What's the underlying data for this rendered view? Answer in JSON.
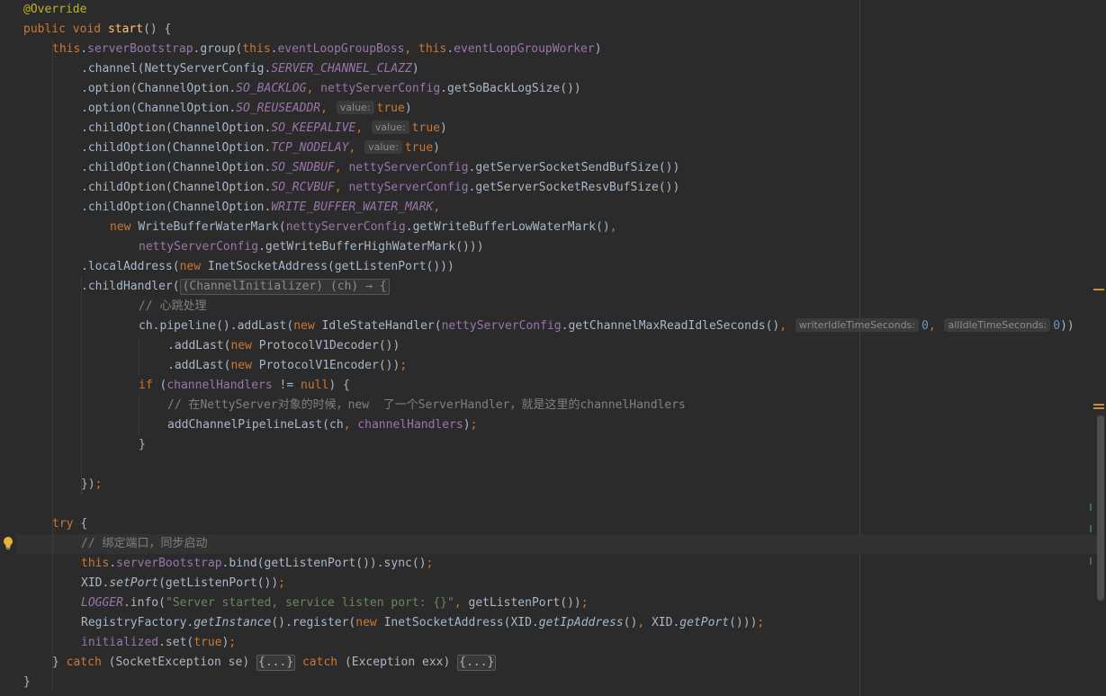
{
  "editor": {
    "lines": [
      {
        "indent": 0,
        "tokens": [
          {
            "t": "@Override",
            "c": "ann"
          }
        ]
      },
      {
        "indent": 0,
        "tokens": [
          {
            "t": "public ",
            "c": "kw"
          },
          {
            "t": "void ",
            "c": "kw"
          },
          {
            "t": "start",
            "c": "method"
          },
          {
            "t": "() {",
            "c": "plain"
          }
        ]
      },
      {
        "indent": 1,
        "tokens": [
          {
            "t": "this",
            "c": "kw"
          },
          {
            "t": ".",
            "c": "plain"
          },
          {
            "t": "serverBootstrap",
            "c": "field"
          },
          {
            "t": ".group(",
            "c": "plain"
          },
          {
            "t": "this",
            "c": "kw"
          },
          {
            "t": ".",
            "c": "plain"
          },
          {
            "t": "eventLoopGroupBoss",
            "c": "field"
          },
          {
            "t": ", ",
            "c": "kw"
          },
          {
            "t": "this",
            "c": "kw"
          },
          {
            "t": ".",
            "c": "plain"
          },
          {
            "t": "eventLoopGroupWorker",
            "c": "field"
          },
          {
            "t": ")",
            "c": "plain"
          }
        ]
      },
      {
        "indent": 2,
        "tokens": [
          {
            "t": ".channel(NettyServerConfig.",
            "c": "plain"
          },
          {
            "t": "SERVER_CHANNEL_CLAZZ",
            "c": "static"
          },
          {
            "t": ")",
            "c": "plain"
          }
        ]
      },
      {
        "indent": 2,
        "tokens": [
          {
            "t": ".option(ChannelOption.",
            "c": "plain"
          },
          {
            "t": "SO_BACKLOG",
            "c": "static"
          },
          {
            "t": ", ",
            "c": "kw"
          },
          {
            "t": "nettyServerConfig",
            "c": "field"
          },
          {
            "t": ".getSoBackLogSize())",
            "c": "plain"
          }
        ]
      },
      {
        "indent": 2,
        "tokens": [
          {
            "t": ".option(ChannelOption.",
            "c": "plain"
          },
          {
            "t": "SO_REUSEADDR",
            "c": "static"
          },
          {
            "t": ", ",
            "c": "kw"
          },
          {
            "t": "value:",
            "c": "hint"
          },
          {
            "t": "true",
            "c": "kw"
          },
          {
            "t": ")",
            "c": "plain"
          }
        ]
      },
      {
        "indent": 2,
        "tokens": [
          {
            "t": ".childOption(ChannelOption.",
            "c": "plain"
          },
          {
            "t": "SO_KEEPALIVE",
            "c": "static"
          },
          {
            "t": ", ",
            "c": "kw"
          },
          {
            "t": "value:",
            "c": "hint"
          },
          {
            "t": "true",
            "c": "kw"
          },
          {
            "t": ")",
            "c": "plain"
          }
        ]
      },
      {
        "indent": 2,
        "tokens": [
          {
            "t": ".childOption(ChannelOption.",
            "c": "plain"
          },
          {
            "t": "TCP_NODELAY",
            "c": "static"
          },
          {
            "t": ", ",
            "c": "kw"
          },
          {
            "t": "value:",
            "c": "hint"
          },
          {
            "t": "true",
            "c": "kw"
          },
          {
            "t": ")",
            "c": "plain"
          }
        ]
      },
      {
        "indent": 2,
        "tokens": [
          {
            "t": ".childOption(ChannelOption.",
            "c": "plain"
          },
          {
            "t": "SO_SNDBUF",
            "c": "static"
          },
          {
            "t": ", ",
            "c": "kw"
          },
          {
            "t": "nettyServerConfig",
            "c": "field"
          },
          {
            "t": ".getServerSocketSendBufSize())",
            "c": "plain"
          }
        ]
      },
      {
        "indent": 2,
        "tokens": [
          {
            "t": ".childOption(ChannelOption.",
            "c": "plain"
          },
          {
            "t": "SO_RCVBUF",
            "c": "static"
          },
          {
            "t": ", ",
            "c": "kw"
          },
          {
            "t": "nettyServerConfig",
            "c": "field"
          },
          {
            "t": ".getServerSocketResvBufSize())",
            "c": "plain"
          }
        ]
      },
      {
        "indent": 2,
        "tokens": [
          {
            "t": ".childOption(ChannelOption.",
            "c": "plain"
          },
          {
            "t": "WRITE_BUFFER_WATER_MARK",
            "c": "static"
          },
          {
            "t": ",",
            "c": "kw"
          }
        ]
      },
      {
        "indent": 3,
        "tokens": [
          {
            "t": "new ",
            "c": "kw"
          },
          {
            "t": "WriteBufferWaterMark(",
            "c": "plain"
          },
          {
            "t": "nettyServerConfig",
            "c": "field"
          },
          {
            "t": ".getWriteBufferLowWaterMark()",
            "c": "plain"
          },
          {
            "t": ",",
            "c": "kw"
          }
        ]
      },
      {
        "indent": 4,
        "tokens": [
          {
            "t": "nettyServerConfig",
            "c": "field"
          },
          {
            "t": ".getWriteBufferHighWaterMark()))",
            "c": "plain"
          }
        ]
      },
      {
        "indent": 2,
        "tokens": [
          {
            "t": ".localAddress(",
            "c": "plain"
          },
          {
            "t": "new ",
            "c": "kw"
          },
          {
            "t": "InetSocketAddress(getListenPort()))",
            "c": "plain"
          }
        ]
      },
      {
        "indent": 2,
        "tokens": [
          {
            "t": ".childHandler(",
            "c": "plain"
          },
          {
            "t": "(ChannelInitializer) (ch) → {",
            "c": "foldlambda"
          }
        ]
      },
      {
        "indent": 4,
        "tokens": [
          {
            "t": "// 心跳处理",
            "c": "comment"
          }
        ]
      },
      {
        "indent": 4,
        "tokens": [
          {
            "t": "ch.pipeline().addLast(",
            "c": "plain"
          },
          {
            "t": "new ",
            "c": "kw"
          },
          {
            "t": "IdleStateHandler(",
            "c": "plain"
          },
          {
            "t": "nettyServerConfig",
            "c": "field"
          },
          {
            "t": ".getChannelMaxReadIdleSeconds()",
            "c": "plain"
          },
          {
            "t": ", ",
            "c": "kw"
          },
          {
            "t": "writerIdleTimeSeconds:",
            "c": "hint"
          },
          {
            "t": "0",
            "c": "num"
          },
          {
            "t": ", ",
            "c": "kw"
          },
          {
            "t": "allIdleTimeSeconds:",
            "c": "hint"
          },
          {
            "t": "0",
            "c": "num"
          },
          {
            "t": "))",
            "c": "plain"
          }
        ]
      },
      {
        "indent": 5,
        "tokens": [
          {
            "t": ".addLast(",
            "c": "plain"
          },
          {
            "t": "new ",
            "c": "kw"
          },
          {
            "t": "ProtocolV1Decoder())",
            "c": "plain"
          }
        ]
      },
      {
        "indent": 5,
        "tokens": [
          {
            "t": ".addLast(",
            "c": "plain"
          },
          {
            "t": "new ",
            "c": "kw"
          },
          {
            "t": "ProtocolV1Encoder())",
            "c": "plain"
          },
          {
            "t": ";",
            "c": "kw"
          }
        ]
      },
      {
        "indent": 4,
        "tokens": [
          {
            "t": "if ",
            "c": "kw"
          },
          {
            "t": "(",
            "c": "plain"
          },
          {
            "t": "channelHandlers",
            "c": "field"
          },
          {
            "t": " != ",
            "c": "plain"
          },
          {
            "t": "null",
            "c": "kw"
          },
          {
            "t": ") {",
            "c": "plain"
          }
        ]
      },
      {
        "indent": 5,
        "tokens": [
          {
            "t": "// 在NettyServer对象的时候，new  了一个ServerHandler，就是这里的channelHandlers",
            "c": "comment"
          }
        ]
      },
      {
        "indent": 5,
        "tokens": [
          {
            "t": "addChannelPipelineLast(ch",
            "c": "plain"
          },
          {
            "t": ", ",
            "c": "kw"
          },
          {
            "t": "channelHandlers",
            "c": "field"
          },
          {
            "t": ")",
            "c": "plain"
          },
          {
            "t": ";",
            "c": "kw"
          }
        ]
      },
      {
        "indent": 4,
        "tokens": [
          {
            "t": "}",
            "c": "plain"
          }
        ]
      },
      {
        "indent": 0,
        "tokens": []
      },
      {
        "indent": 2,
        "tokens": [
          {
            "t": "})",
            "c": "plain"
          },
          {
            "t": ";",
            "c": "kw"
          }
        ]
      },
      {
        "indent": 0,
        "tokens": []
      },
      {
        "indent": 1,
        "tokens": [
          {
            "t": "try ",
            "c": "kw"
          },
          {
            "t": "{",
            "c": "plain"
          }
        ]
      },
      {
        "indent": 2,
        "tokens": [
          {
            "t": "// 绑定端口，同步启动",
            "c": "comment"
          }
        ]
      },
      {
        "indent": 2,
        "tokens": [
          {
            "t": "this",
            "c": "kw"
          },
          {
            "t": ".",
            "c": "plain"
          },
          {
            "t": "serverBootstrap",
            "c": "field"
          },
          {
            "t": ".bind(getListenPort()).sync()",
            "c": "plain"
          },
          {
            "t": ";",
            "c": "kw"
          }
        ]
      },
      {
        "indent": 2,
        "tokens": [
          {
            "t": "XID.",
            "c": "plain"
          },
          {
            "t": "setPort",
            "c": "italic"
          },
          {
            "t": "(getListenPort())",
            "c": "plain"
          },
          {
            "t": ";",
            "c": "kw"
          }
        ]
      },
      {
        "indent": 2,
        "tokens": [
          {
            "t": "LOGGER",
            "c": "static"
          },
          {
            "t": ".info(",
            "c": "plain"
          },
          {
            "t": "\"Server started, service listen port: {}\"",
            "c": "string"
          },
          {
            "t": ", ",
            "c": "kw"
          },
          {
            "t": "getListenPort())",
            "c": "plain"
          },
          {
            "t": ";",
            "c": "kw"
          }
        ]
      },
      {
        "indent": 2,
        "tokens": [
          {
            "t": "RegistryFactory.",
            "c": "plain"
          },
          {
            "t": "getInstance",
            "c": "italic"
          },
          {
            "t": "().register(",
            "c": "plain"
          },
          {
            "t": "new ",
            "c": "kw"
          },
          {
            "t": "InetSocketAddress(XID.",
            "c": "plain"
          },
          {
            "t": "getIpAddress",
            "c": "italic"
          },
          {
            "t": "()",
            "c": "plain"
          },
          {
            "t": ", ",
            "c": "kw"
          },
          {
            "t": "XID.",
            "c": "plain"
          },
          {
            "t": "getPort",
            "c": "italic"
          },
          {
            "t": "()))",
            "c": "plain"
          },
          {
            "t": ";",
            "c": "kw"
          }
        ]
      },
      {
        "indent": 2,
        "tokens": [
          {
            "t": "initialized",
            "c": "field"
          },
          {
            "t": ".set(",
            "c": "plain"
          },
          {
            "t": "true",
            "c": "kw"
          },
          {
            "t": ")",
            "c": "plain"
          },
          {
            "t": ";",
            "c": "kw"
          }
        ]
      },
      {
        "indent": 1,
        "tokens": [
          {
            "t": "} ",
            "c": "plain"
          },
          {
            "t": "catch ",
            "c": "kw"
          },
          {
            "t": "(SocketException se) ",
            "c": "plain"
          },
          {
            "t": "{...}",
            "c": "fold"
          },
          {
            "t": " ",
            "c": "plain"
          },
          {
            "t": "catch ",
            "c": "kw"
          },
          {
            "t": "(Exception exx) ",
            "c": "plain"
          },
          {
            "t": "{...}",
            "c": "fold"
          }
        ]
      },
      {
        "indent": 0,
        "tokens": [
          {
            "t": "}",
            "c": "plain"
          }
        ]
      }
    ]
  },
  "colors": {
    "background": "#2b2b2b",
    "keyword": "#cc7832",
    "annotation": "#bbb529",
    "field": "#9876aa",
    "method": "#ffc66d",
    "comment": "#808080",
    "string": "#6a8759",
    "number": "#6897bb",
    "text": "#a9b7c6"
  },
  "icons": {
    "gutter": "lightbulb-icon"
  }
}
